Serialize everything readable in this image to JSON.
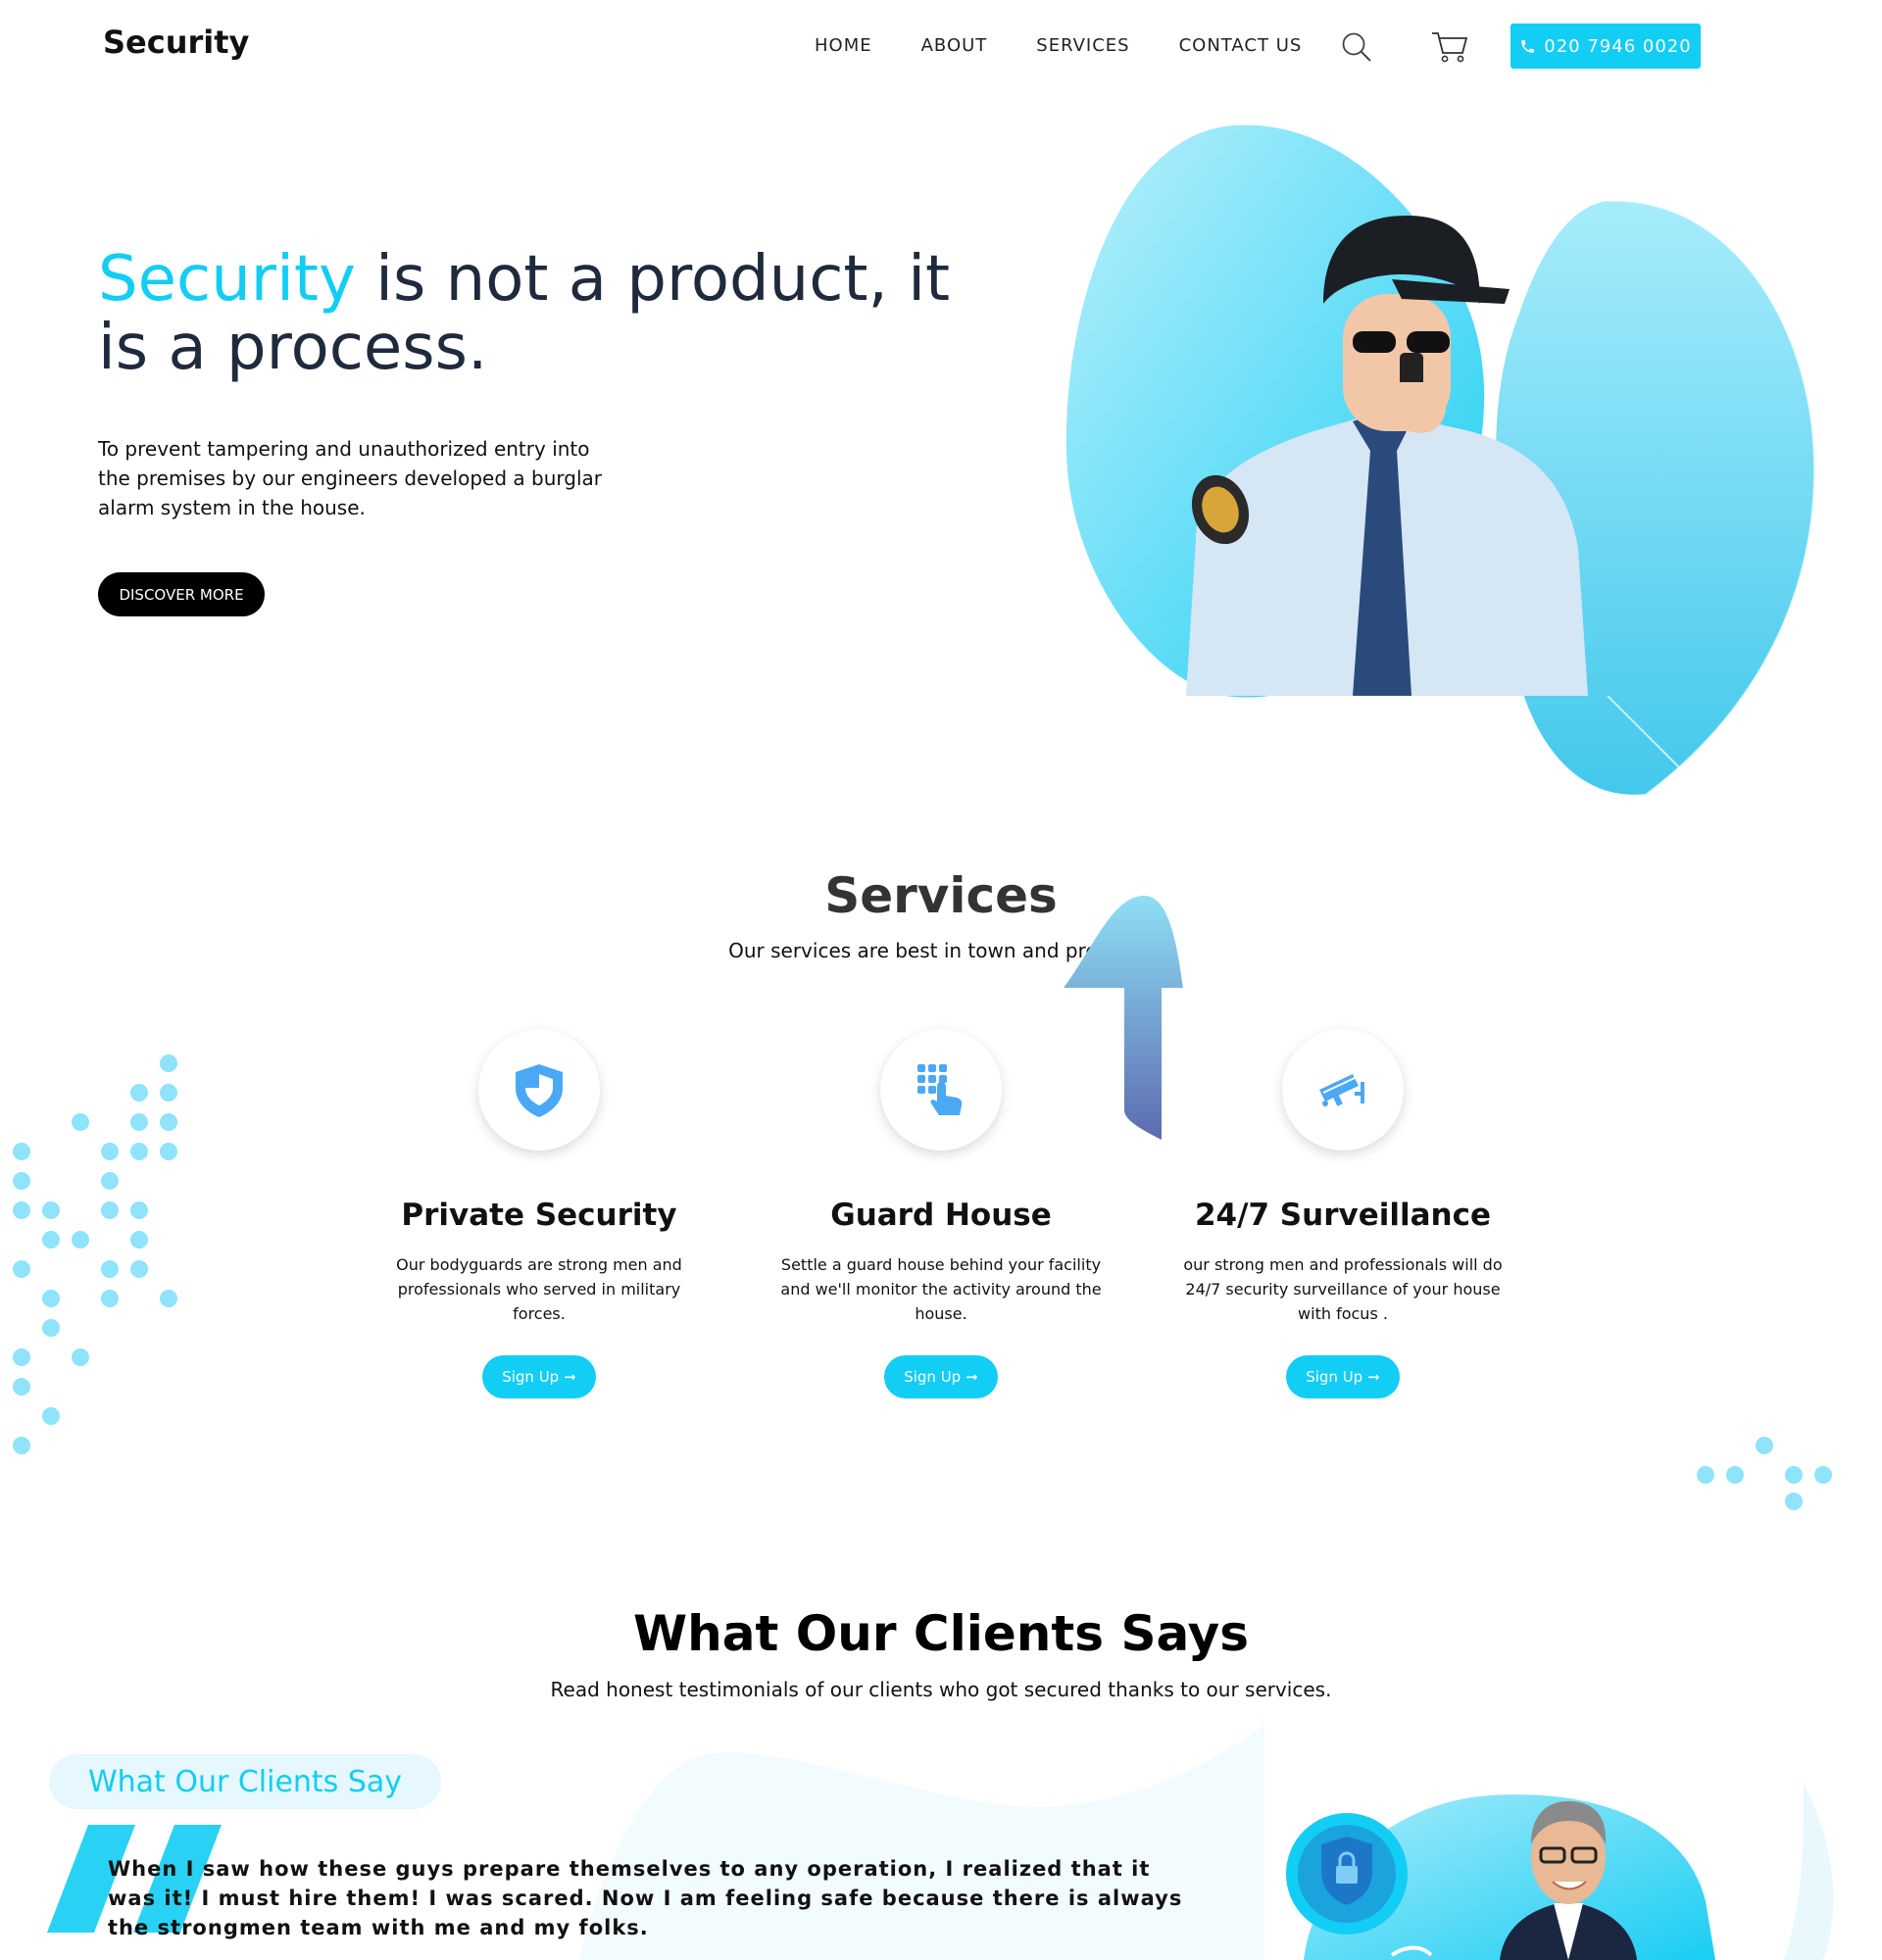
{
  "header": {
    "logo": "Security",
    "nav": [
      "HOME",
      "ABOUT",
      "SERVICES",
      "CONTACT US"
    ],
    "phone": "020 7946 0020",
    "icons": {
      "search": "search-icon",
      "cart": "cart-icon",
      "phone": "phone-icon"
    }
  },
  "hero": {
    "title_accent": "Security",
    "title_rest": " is not a product, it is a process.",
    "description": "To prevent tampering and unauthorized entry into the premises by our engineers developed a burglar alarm system in the house.",
    "button": "DISCOVER MORE"
  },
  "services": {
    "title": "Services",
    "subtitle": "Our services are best in town and premium",
    "items": [
      {
        "title": "Private Security",
        "text": "Our bodyguards are strong men and professionals who served in military forces.",
        "button": "Sign Up",
        "icon": "shield-icon"
      },
      {
        "title": "Guard House",
        "text": "Settle a guard house behind your facility and we'll monitor the activity around the house.",
        "button": "Sign Up",
        "icon": "keypad-icon"
      },
      {
        "title": "24/7 Surveillance",
        "text": "our strong men and professionals will do 24/7 security surveillance of your house with focus .",
        "button": "Sign Up",
        "icon": "cctv-camera-icon"
      }
    ]
  },
  "testimonials": {
    "title": "What Our Clients Says",
    "subtitle": "Read honest testimonials of our clients who got secured thanks to our services.",
    "pill": "What Our Clients Say",
    "quote": "When I saw how these guys prepare themselves to any operation, I realized that it was it! I must hire them! I was scared. Now I am feeling safe because there is always the strongmen team with me and my folks."
  },
  "colors": {
    "accent": "#12cdf4",
    "dark": "#1f2a3c",
    "button_dark": "#000000"
  }
}
